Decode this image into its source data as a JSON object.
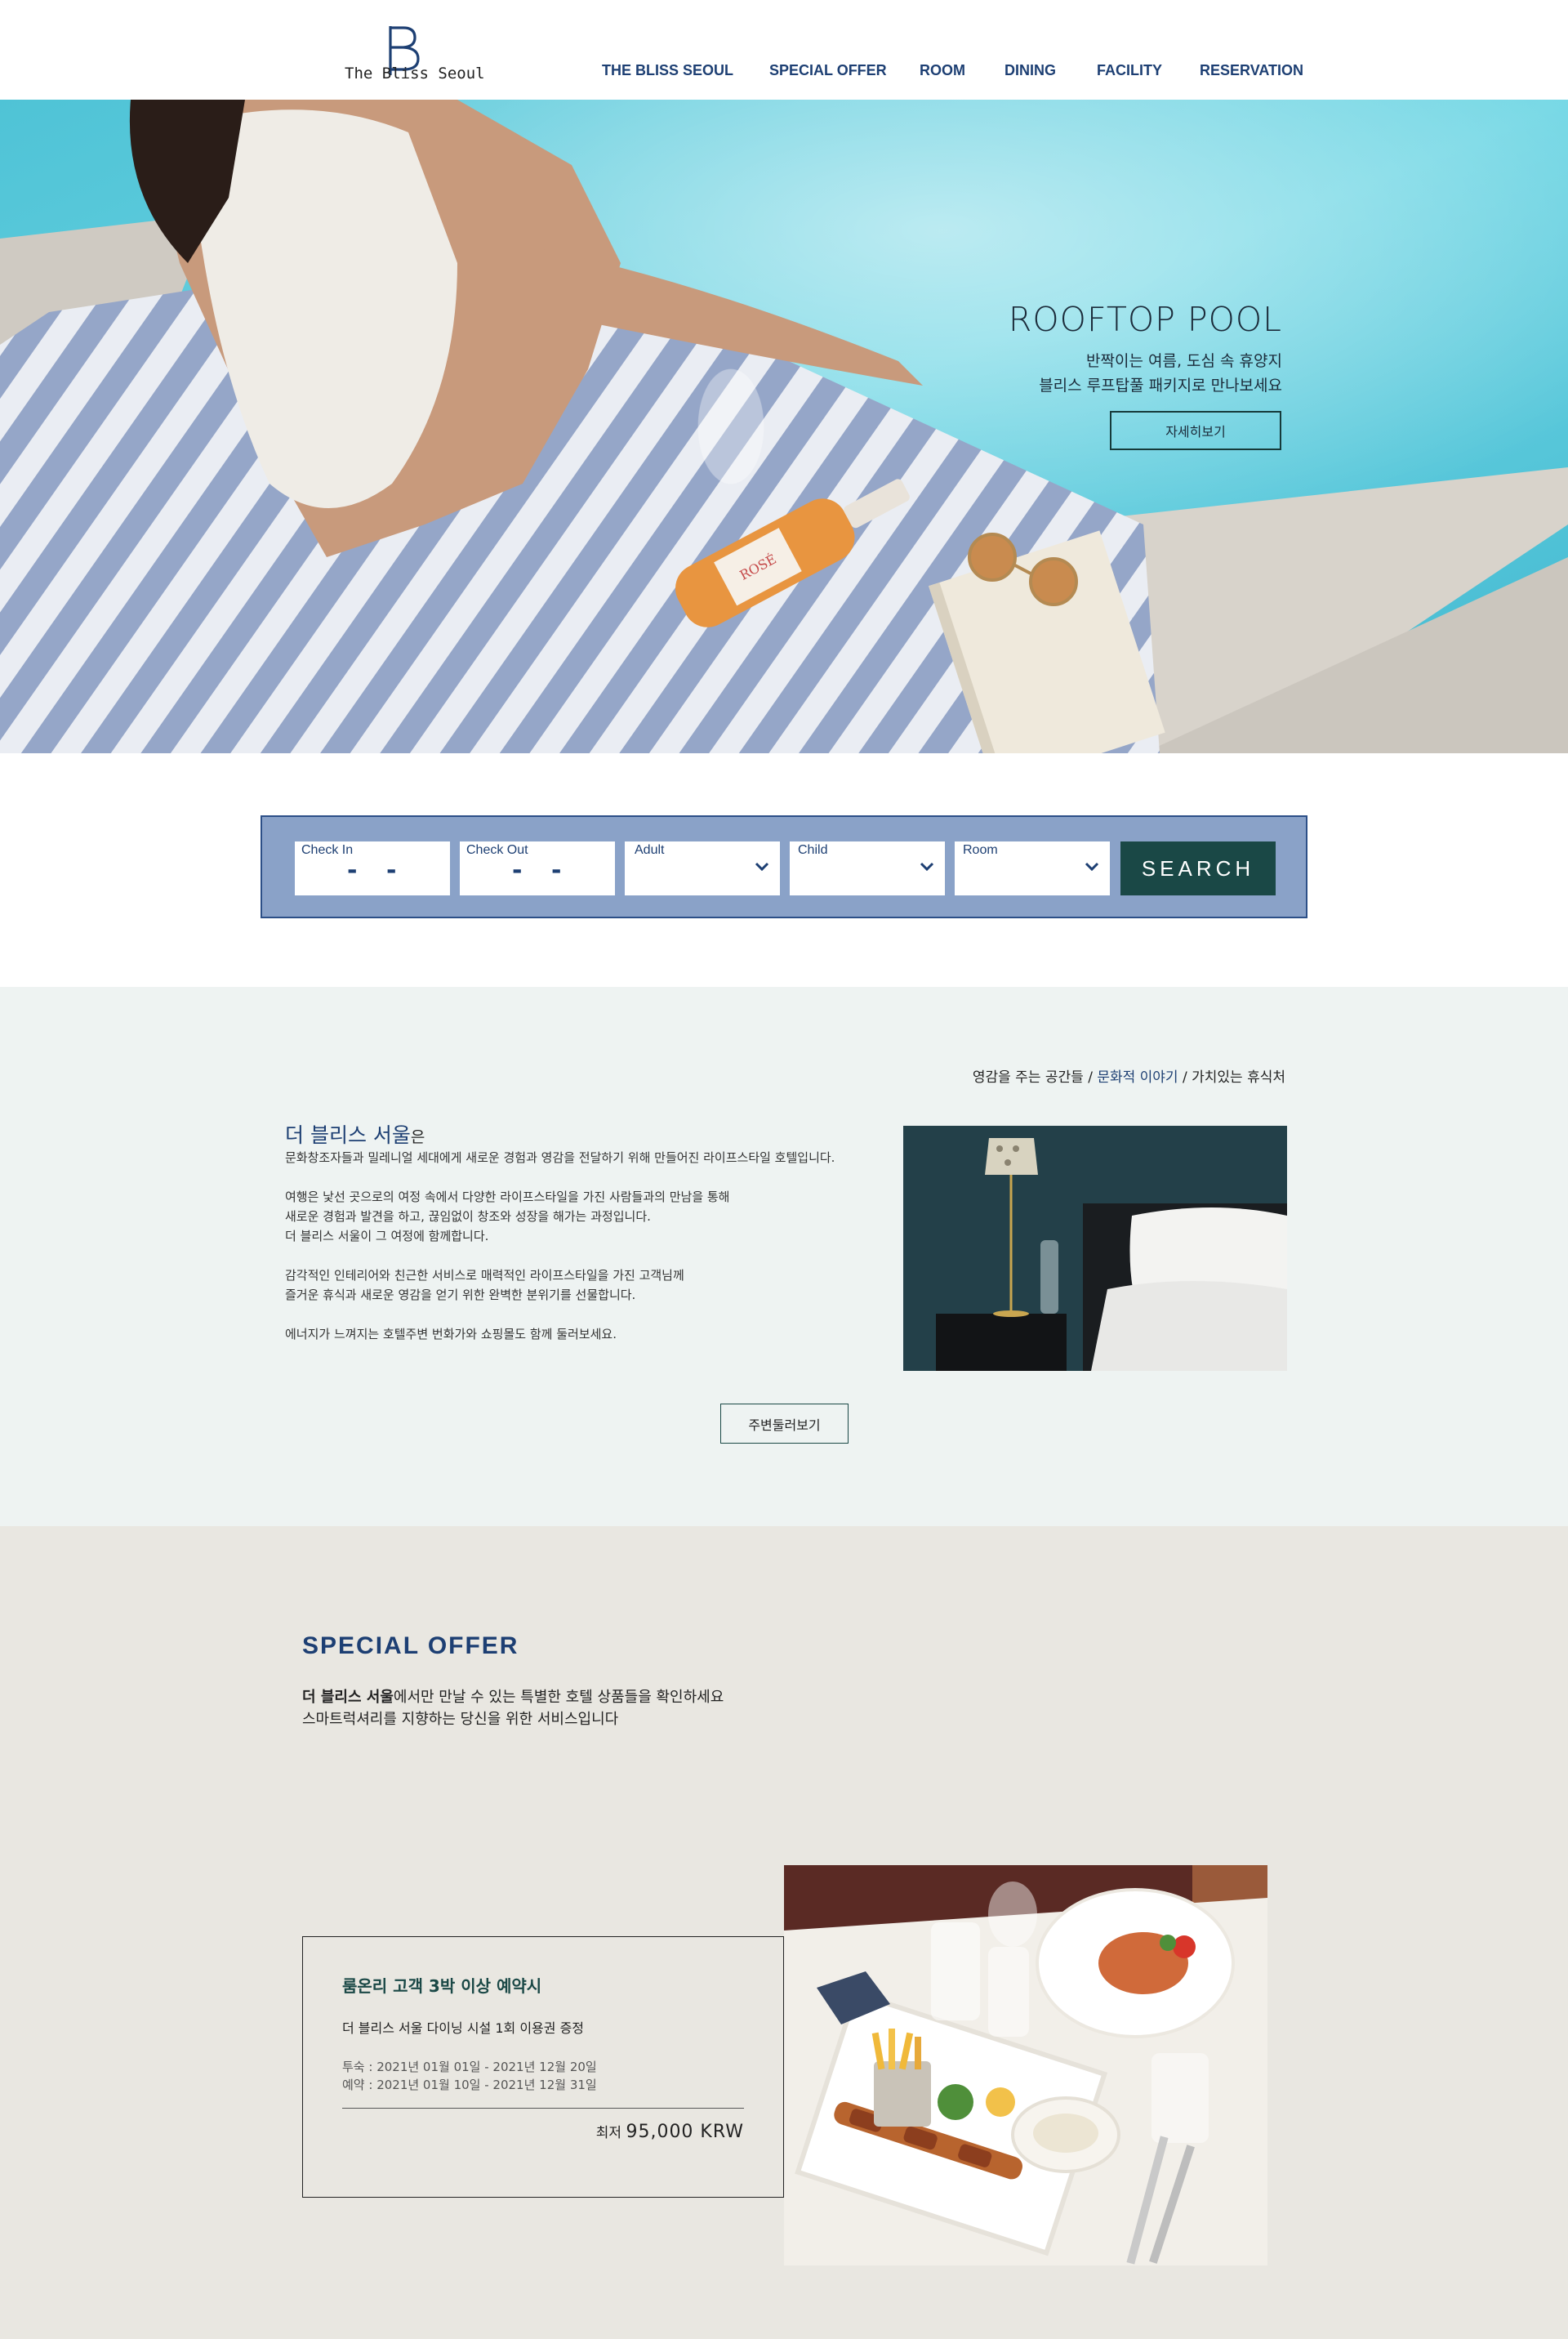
{
  "brand": {
    "logo_letter": "B",
    "name": "The Bliss Seoul"
  },
  "nav": [
    "THE BLISS SEOUL",
    "SPECIAL OFFER",
    "ROOM",
    "DINING",
    "FACILITY",
    "RESERVATION"
  ],
  "hero": {
    "title": "ROOFTOP POOL",
    "line1": "반짝이는 여름, 도심 속 휴양지",
    "line2": "블리스 루프탑풀 패키지로 만나보세요",
    "button": "자세히보기",
    "bottle_label": "ROSÉ"
  },
  "booking": {
    "check_in": "Check In",
    "check_out": "Check Out",
    "adult": "Adult",
    "child": "Child",
    "room": "Room",
    "date_sep": "-",
    "search": "SEARCH"
  },
  "about": {
    "crumb_a": "영감을 주는 공간들 /",
    "crumb_b": "문화적 이야기",
    "crumb_c": "/ 가치있는 휴식처",
    "title": "더 블리스 서울",
    "title_suffix": "은",
    "p1": "문화창조자들과 밀레니얼 세대에게 새로운 경험과 영감을 전달하기 위해 만들어진 라이프스타일 호텔입니다.",
    "p2": "여행은 낯선 곳으로의 여정 속에서 다양한 라이프스타일을 가진 사람들과의 만남을 통해",
    "p3": "새로운 경험과 발견을 하고, 끊임없이 창조와 성장을 해가는 과정입니다.",
    "p4": "더 블리스 서울이 그 여정에 함께합니다.",
    "p5": "감각적인 인테리어와 친근한 서비스로 매력적인 라이프스타일을 가진 고객님께",
    "p6": "즐거운 휴식과 새로운 영감을 얻기 위한 완벽한 분위기를 선물합니다.",
    "p7": "에너지가 느껴지는 호텔주변 번화가와 쇼핑몰도 함께 둘러보세요.",
    "button": "주변둘러보기"
  },
  "offer": {
    "title": "SPECIAL OFFER",
    "desc_bold": "더 블리스 서울",
    "desc_rest": "에서만 만날 수 있는 특별한 호텔 상품들을 확인하세요",
    "desc_line2": "스마트럭셔리를 지향하는 당신을 위한 서비스입니다",
    "card": {
      "title": "룸온리 고객 3박 이상 예약시",
      "sub": "더 블리스 서울 다이닝 시설 1회 이용권 증정",
      "stay": "투숙 : 2021년 01월 01일 - 2021년 12월 20일",
      "booking": "예약 : 2021년 01월 10일 - 2021년 12월 31일",
      "price_prefix": "최저",
      "price": "95,000 KRW"
    }
  },
  "colors": {
    "navy": "#1d3f73",
    "dark_green": "#1a4846",
    "booking_bg": "#8aa2c8"
  }
}
